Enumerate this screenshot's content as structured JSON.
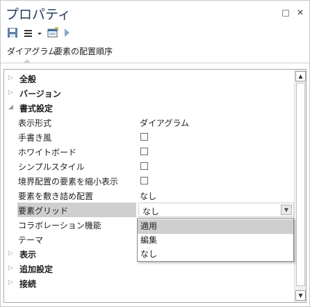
{
  "title": "プロパティ",
  "window_buttons": {
    "restore": "□",
    "close": "✕"
  },
  "toolbar": {
    "save_icon": "save-icon",
    "menu_icon": "menu-icon",
    "dropdown_icon": "chevron-down-icon",
    "window_icon": "window-icon",
    "play_icon": "play-icon"
  },
  "tabs": [
    {
      "label": "ダイアグラム",
      "active": true
    },
    {
      "label": "要素の配置順序",
      "active": false
    }
  ],
  "grid": {
    "categories": [
      {
        "label": "全般",
        "expanded": false
      },
      {
        "label": "バージョン",
        "expanded": false
      },
      {
        "label": "書式設定",
        "expanded": true
      },
      {
        "label": "表示",
        "expanded": false
      },
      {
        "label": "追加設定",
        "expanded": false
      },
      {
        "label": "接続",
        "expanded": false
      }
    ],
    "props": [
      {
        "label": "表示形式",
        "value": "ダイアグラム"
      },
      {
        "label": "手書き風",
        "checked": false
      },
      {
        "label": "ホワイトボード",
        "checked": false
      },
      {
        "label": "シンプルスタイル",
        "checked": false
      },
      {
        "label": "境界配置の要素を縮小表示",
        "checked": false
      },
      {
        "label": "要素を敷き詰め配置",
        "value": "なし"
      },
      {
        "label": "要素グリッド",
        "value": "なし",
        "selected": true
      },
      {
        "label": "コラボレーション機能",
        "value": ""
      },
      {
        "label": "テーマ",
        "value": ""
      }
    ]
  },
  "dropdown": {
    "options": [
      "適用",
      "編集",
      "なし"
    ],
    "highlighted": "適用"
  },
  "scrollbar": {
    "up": "▲",
    "down": "▼"
  },
  "colors": {
    "title": "#1f3a5f",
    "selection": "#cfcfcf",
    "border": "#a8a8a8"
  }
}
